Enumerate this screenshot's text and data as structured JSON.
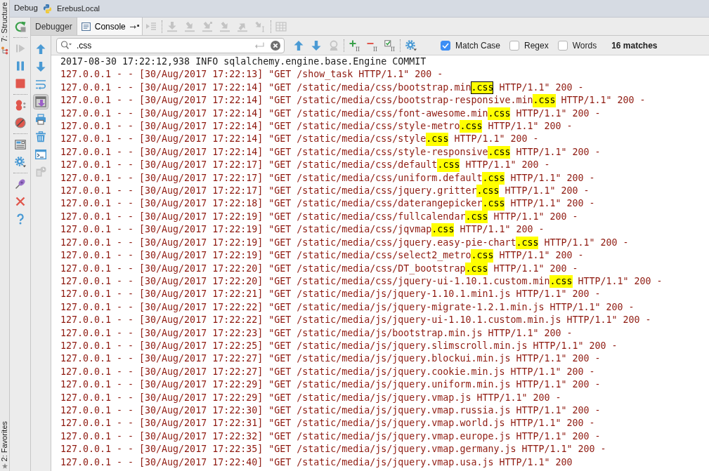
{
  "window": {
    "title": "Debug",
    "configuration": "ErebusLocal"
  },
  "side_bar": {
    "top_tab": "7: Structure",
    "bottom_tab": "2: Favorites"
  },
  "debug_toolbar": [
    {
      "kind": "rerun",
      "disabled": false
    },
    {
      "kind": "separator"
    },
    {
      "kind": "resume",
      "disabled": true
    },
    {
      "kind": "pause",
      "disabled": false
    },
    {
      "kind": "stop",
      "disabled": false
    },
    {
      "kind": "separator"
    },
    {
      "kind": "view-breakpoints",
      "disabled": false
    },
    {
      "kind": "mute-breakpoints",
      "disabled": false
    },
    {
      "kind": "separator"
    },
    {
      "kind": "restore-layout",
      "disabled": false
    },
    {
      "kind": "settings",
      "disabled": false
    },
    {
      "kind": "separator"
    },
    {
      "kind": "pin",
      "disabled": false
    },
    {
      "kind": "close",
      "disabled": false
    },
    {
      "kind": "help",
      "disabled": false
    }
  ],
  "tabs": [
    {
      "kind": "debugger",
      "label": "Debugger",
      "selected": false
    },
    {
      "kind": "console",
      "label": "Console",
      "selected": true
    }
  ],
  "stepping_toolbar": [
    {
      "kind": "show-execution-point",
      "disabled": true
    },
    {
      "kind": "separator"
    },
    {
      "kind": "step-over",
      "disabled": true
    },
    {
      "kind": "step-into",
      "disabled": true
    },
    {
      "kind": "step-into-my-code",
      "disabled": true
    },
    {
      "kind": "force-step-into",
      "disabled": true
    },
    {
      "kind": "step-out",
      "disabled": true
    },
    {
      "kind": "run-to-cursor",
      "disabled": true
    },
    {
      "kind": "separator"
    },
    {
      "kind": "evaluate",
      "disabled": true
    }
  ],
  "console_toolbar": [
    {
      "kind": "up",
      "disabled": false
    },
    {
      "kind": "down",
      "disabled": false
    },
    {
      "kind": "soft-wrap",
      "on": false,
      "disabled": false
    },
    {
      "kind": "scroll-to-end",
      "on": true,
      "disabled": false
    },
    {
      "kind": "print",
      "disabled": false
    },
    {
      "kind": "clear",
      "disabled": false
    },
    {
      "kind": "terminal",
      "disabled": false
    },
    {
      "kind": "history",
      "disabled": true
    }
  ],
  "search": {
    "value": ".css",
    "tools": [
      {
        "kind": "up",
        "disabled": false
      },
      {
        "kind": "down",
        "disabled": false
      },
      {
        "kind": "find-usages",
        "disabled": true
      },
      {
        "kind": "separator"
      },
      {
        "kind": "add-occurrence",
        "disabled": false
      },
      {
        "kind": "remove-occurrence",
        "disabled": false
      },
      {
        "kind": "select-all-occurrences",
        "disabled": false
      },
      {
        "kind": "separator"
      },
      {
        "kind": "settings",
        "disabled": false
      }
    ],
    "options": [
      {
        "label": "Match Case",
        "checked": true
      },
      {
        "label": "Regex",
        "checked": false
      },
      {
        "label": "Words",
        "checked": false
      }
    ],
    "status": "16 matches"
  },
  "console": {
    "lines": [
      {
        "kind": "log",
        "text": "2017-08-30 17:22:12,938 INFO sqlalchemy.engine.base.Engine COMMIT"
      },
      {
        "kind": "request",
        "text": "127.0.0.1 - - [30/Aug/2017 17:22:13] \"GET /show_task HTTP/1.1\" 200 -"
      },
      {
        "kind": "match",
        "before": "127.0.0.1 - - [30/Aug/2017 17:22:14] \"GET /static/media/css/bootstrap.min",
        "match": ".css",
        "after": " HTTP/1.1\" 200 -",
        "selected": true
      },
      {
        "kind": "match",
        "before": "127.0.0.1 - - [30/Aug/2017 17:22:14] \"GET /static/media/css/bootstrap-responsive.min",
        "match": ".css",
        "after": " HTTP/1.1\" 200 -",
        "selected": false
      },
      {
        "kind": "match",
        "before": "127.0.0.1 - - [30/Aug/2017 17:22:14] \"GET /static/media/css/font-awesome.min",
        "match": ".css",
        "after": " HTTP/1.1\" 200 -",
        "selected": false
      },
      {
        "kind": "match",
        "before": "127.0.0.1 - - [30/Aug/2017 17:22:14] \"GET /static/media/css/style-metro",
        "match": ".css",
        "after": " HTTP/1.1\" 200 -",
        "selected": false
      },
      {
        "kind": "match",
        "before": "127.0.0.1 - - [30/Aug/2017 17:22:14] \"GET /static/media/css/style",
        "match": ".css",
        "after": " HTTP/1.1\" 200 -",
        "selected": false
      },
      {
        "kind": "match",
        "before": "127.0.0.1 - - [30/Aug/2017 17:22:14] \"GET /static/media/css/style-responsive",
        "match": ".css",
        "after": " HTTP/1.1\" 200 -",
        "selected": false
      },
      {
        "kind": "match",
        "before": "127.0.0.1 - - [30/Aug/2017 17:22:17] \"GET /static/media/css/default",
        "match": ".css",
        "after": " HTTP/1.1\" 200 -",
        "selected": false
      },
      {
        "kind": "match",
        "before": "127.0.0.1 - - [30/Aug/2017 17:22:17] \"GET /static/media/css/uniform.default",
        "match": ".css",
        "after": " HTTP/1.1\" 200 -",
        "selected": false
      },
      {
        "kind": "match",
        "before": "127.0.0.1 - - [30/Aug/2017 17:22:17] \"GET /static/media/css/jquery.gritter",
        "match": ".css",
        "after": " HTTP/1.1\" 200 -",
        "selected": false
      },
      {
        "kind": "match",
        "before": "127.0.0.1 - - [30/Aug/2017 17:22:18] \"GET /static/media/css/daterangepicker",
        "match": ".css",
        "after": " HTTP/1.1\" 200 -",
        "selected": false
      },
      {
        "kind": "match",
        "before": "127.0.0.1 - - [30/Aug/2017 17:22:19] \"GET /static/media/css/fullcalendar",
        "match": ".css",
        "after": " HTTP/1.1\" 200 -",
        "selected": false
      },
      {
        "kind": "match",
        "before": "127.0.0.1 - - [30/Aug/2017 17:22:19] \"GET /static/media/css/jqvmap",
        "match": ".css",
        "after": " HTTP/1.1\" 200 -",
        "selected": false
      },
      {
        "kind": "match",
        "before": "127.0.0.1 - - [30/Aug/2017 17:22:19] \"GET /static/media/css/jquery.easy-pie-chart",
        "match": ".css",
        "after": " HTTP/1.1\" 200 -",
        "selected": false
      },
      {
        "kind": "match",
        "before": "127.0.0.1 - - [30/Aug/2017 17:22:19] \"GET /static/media/css/select2_metro",
        "match": ".css",
        "after": " HTTP/1.1\" 200 -",
        "selected": false
      },
      {
        "kind": "match",
        "before": "127.0.0.1 - - [30/Aug/2017 17:22:20] \"GET /static/media/css/DT_bootstrap",
        "match": ".css",
        "after": " HTTP/1.1\" 200 -",
        "selected": false
      },
      {
        "kind": "match",
        "before": "127.0.0.1 - - [30/Aug/2017 17:22:20] \"GET /static/media/css/jquery-ui-1.10.1.custom.min",
        "match": ".css",
        "after": " HTTP/1.1\" 200 -",
        "selected": false
      },
      {
        "kind": "request",
        "text": "127.0.0.1 - - [30/Aug/2017 17:22:21] \"GET /static/media/js/jquery-1.10.1.min1.js HTTP/1.1\" 200 -"
      },
      {
        "kind": "request",
        "text": "127.0.0.1 - - [30/Aug/2017 17:22:22] \"GET /static/media/js/jquery-migrate-1.2.1.min.js HTTP/1.1\" 200 -"
      },
      {
        "kind": "request",
        "text": "127.0.0.1 - - [30/Aug/2017 17:22:22] \"GET /static/media/js/jquery-ui-1.10.1.custom.min.js HTTP/1.1\" 200 -"
      },
      {
        "kind": "request",
        "text": "127.0.0.1 - - [30/Aug/2017 17:22:23] \"GET /static/media/js/bootstrap.min.js HTTP/1.1\" 200 -"
      },
      {
        "kind": "request",
        "text": "127.0.0.1 - - [30/Aug/2017 17:22:25] \"GET /static/media/js/jquery.slimscroll.min.js HTTP/1.1\" 200 -"
      },
      {
        "kind": "request",
        "text": "127.0.0.1 - - [30/Aug/2017 17:22:27] \"GET /static/media/js/jquery.blockui.min.js HTTP/1.1\" 200 -"
      },
      {
        "kind": "request",
        "text": "127.0.0.1 - - [30/Aug/2017 17:22:27] \"GET /static/media/js/jquery.cookie.min.js HTTP/1.1\" 200 -"
      },
      {
        "kind": "request",
        "text": "127.0.0.1 - - [30/Aug/2017 17:22:29] \"GET /static/media/js/jquery.uniform.min.js HTTP/1.1\" 200 -"
      },
      {
        "kind": "request",
        "text": "127.0.0.1 - - [30/Aug/2017 17:22:29] \"GET /static/media/js/jquery.vmap.js HTTP/1.1\" 200 -"
      },
      {
        "kind": "request",
        "text": "127.0.0.1 - - [30/Aug/2017 17:22:30] \"GET /static/media/js/jquery.vmap.russia.js HTTP/1.1\" 200 -"
      },
      {
        "kind": "request",
        "text": "127.0.0.1 - - [30/Aug/2017 17:22:31] \"GET /static/media/js/jquery.vmap.world.js HTTP/1.1\" 200 -"
      },
      {
        "kind": "request",
        "text": "127.0.0.1 - - [30/Aug/2017 17:22:32] \"GET /static/media/js/jquery.vmap.europe.js HTTP/1.1\" 200 -"
      },
      {
        "kind": "request",
        "text": "127.0.0.1 - - [30/Aug/2017 17:22:35] \"GET /static/media/js/jquery.vmap.germany.js HTTP/1.1\" 200 -"
      },
      {
        "kind": "request",
        "text": "127.0.0.1 - - [30/Aug/2017 17:22:40] \"GET /static/media/js/jquery.vmap.usa.js HTTP/1.1\" 200"
      }
    ]
  }
}
